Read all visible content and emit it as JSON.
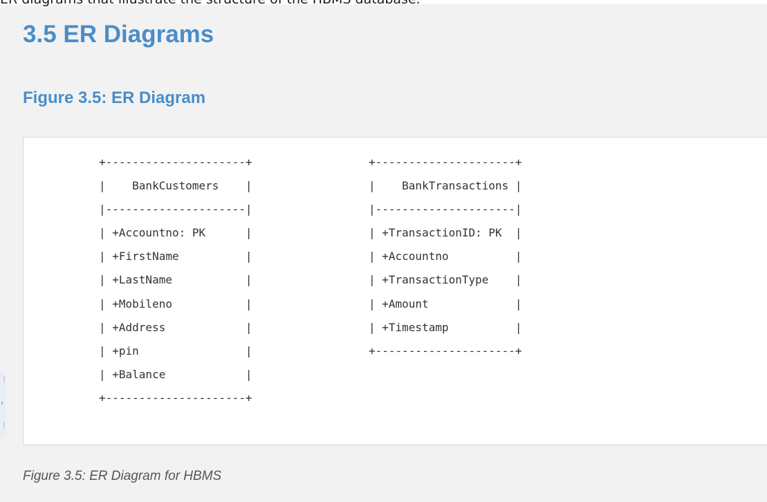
{
  "intro_text": "ER diagrams that illustrate the structure of the HBMS database.",
  "section_heading": "3.5 ER Diagrams",
  "figure_heading": "Figure 3.5: ER Diagram",
  "diagram": {
    "left_table": [
      "+---------------------+",
      "|    BankCustomers    |",
      "|---------------------|",
      "| +Accountno: PK      |",
      "| +FirstName          |",
      "| +LastName           |",
      "| +Mobileno           |",
      "| +Address            |",
      "| +pin                |",
      "| +Balance            |",
      "+---------------------+"
    ],
    "right_table": [
      "+---------------------+",
      "|    BankTransactions |",
      "|---------------------|",
      "| +TransactionID: PK  |",
      "| +Accountno          |",
      "| +TransactionType    |",
      "| +Amount             |",
      "| +Timestamp          |",
      "+---------------------+"
    ]
  },
  "caption": "Figure 3.5: ER Diagram for HBMS",
  "colors": {
    "heading": "#4a8dc8",
    "code_bg": "#ffffff",
    "page_bg": "#f2f2f2"
  }
}
